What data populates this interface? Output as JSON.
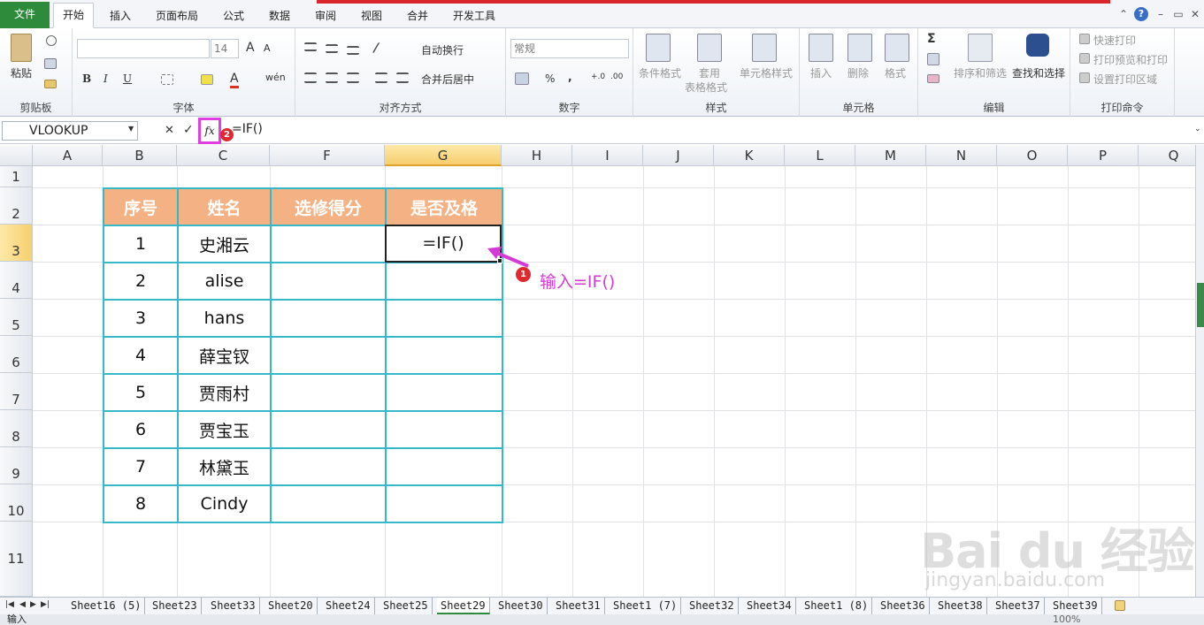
{
  "tabs": [
    "文件",
    "开始",
    "插入",
    "页面布局",
    "公式",
    "数据",
    "审阅",
    "视图",
    "合并",
    "开发工具"
  ],
  "window": {
    "help_label": "?",
    "min_label": "–",
    "restore_label": "▭",
    "close_label": "✕",
    "collapse_label": "⌃"
  },
  "ribbon": {
    "clipboard": {
      "paste": "粘贴",
      "label": "剪贴板"
    },
    "font": {
      "size": "14",
      "bold": "B",
      "italic": "I",
      "underline": "U",
      "wen": "wén",
      "label": "字体"
    },
    "align": {
      "wrap": "自动换行",
      "merge": "合并后居中",
      "label": "对齐方式"
    },
    "number": {
      "format": "常规",
      "percent": "%",
      "comma": ",",
      "label": "数字"
    },
    "styles": {
      "cond": "条件格式",
      "table1": "套用",
      "table2": "表格格式",
      "cell": "单元格样式",
      "label": "样式"
    },
    "cells": {
      "insert": "插入",
      "delete": "删除",
      "format": "格式",
      "label": "单元格"
    },
    "edit": {
      "sigma": "Σ",
      "sort": "排序和筛选",
      "find": "查找和选择",
      "label": "编辑"
    },
    "print": {
      "quick": "快速打印",
      "preview": "打印预览和打印",
      "area": "设置打印区域",
      "label": "打印命令"
    }
  },
  "formula_bar": {
    "name_box": "VLOOKUP",
    "cancel": "✕",
    "enter": "✓",
    "fx": "fx",
    "badge": "2",
    "formula": "=IF()"
  },
  "columns": [
    "A",
    "B",
    "C",
    "F",
    "G",
    "H",
    "I",
    "J",
    "K",
    "L",
    "M",
    "N",
    "O",
    "P",
    "Q"
  ],
  "rows": [
    "1",
    "2",
    "3",
    "4",
    "5",
    "6",
    "7",
    "8",
    "9",
    "10",
    "11"
  ],
  "table": {
    "headers": [
      "序号",
      "姓名",
      "选修得分",
      "是否及格"
    ],
    "rows": [
      [
        "1",
        "史湘云"
      ],
      [
        "2",
        "alise"
      ],
      [
        "3",
        "hans"
      ],
      [
        "4",
        "薛宝钗"
      ],
      [
        "5",
        "贾雨村"
      ],
      [
        "6",
        "贾宝玉"
      ],
      [
        "7",
        "林黛玉"
      ],
      [
        "8",
        "Cindy"
      ]
    ]
  },
  "active_cell": {
    "ref": "G3",
    "value": "=IF()"
  },
  "annotation": {
    "badge": "1",
    "text": "输入=IF()"
  },
  "watermark": {
    "line1": "Bai du 经验",
    "line2": "jingyan.baidu.com"
  },
  "sheet_tabs": [
    "Sheet16 (5)",
    "Sheet23",
    "Sheet33",
    "Sheet20",
    "Sheet24",
    "Sheet25",
    "Sheet29",
    "Sheet30",
    "Sheet31",
    "Sheet1 (7)",
    "Sheet32",
    "Sheet34",
    "Sheet1 (8)",
    "Sheet36",
    "Sheet38",
    "Sheet37",
    "Sheet39"
  ],
  "active_sheet": "Sheet29",
  "status": {
    "mode": "输入",
    "zoom": "100%"
  },
  "colors": {
    "file_tab": "#2e8b3c",
    "table_header": "#f4b183",
    "table_border": "#35b8c8",
    "annotation": "#d63ad6",
    "highlight": "#e040e0",
    "badge": "#e0282e"
  }
}
